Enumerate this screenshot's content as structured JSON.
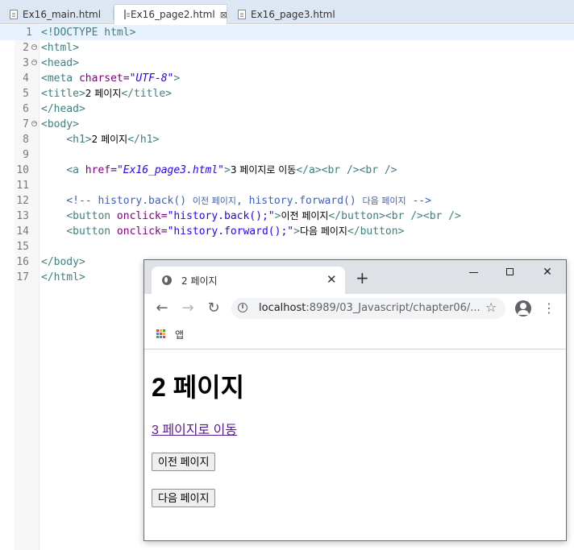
{
  "editor_tabs": [
    {
      "label": "Ex16_main.html",
      "active": false
    },
    {
      "label": "Ex16_page2.html",
      "active": true,
      "close": "⊠"
    },
    {
      "label": "Ex16_page3.html",
      "active": false
    }
  ],
  "code_lines": [
    {
      "n": "1"
    },
    {
      "n": "2"
    },
    {
      "n": "3"
    },
    {
      "n": "4"
    },
    {
      "n": "5"
    },
    {
      "n": "6"
    },
    {
      "n": "7"
    },
    {
      "n": "8"
    },
    {
      "n": "9"
    },
    {
      "n": "10"
    },
    {
      "n": "11"
    },
    {
      "n": "12"
    },
    {
      "n": "13"
    },
    {
      "n": "14"
    },
    {
      "n": "15"
    },
    {
      "n": "16"
    },
    {
      "n": "17"
    }
  ],
  "code": {
    "l1": "<!DOCTYPE html>",
    "l2": "<html>",
    "l3": "<head>",
    "l4_tag": "<meta",
    "l4_attr": " charset=",
    "l4_val": "\"UTF-8\"",
    "l4_end": ">",
    "l5_open": "<title>",
    "l5_text": "2 페이지",
    "l5_close": "</title>",
    "l6": "</head>",
    "l7": "<body>",
    "l8_open": "<h1>",
    "l8_text": "2 페이지",
    "l8_close": "</h1>",
    "l10_tag": "<a",
    "l10_attr": " href=",
    "l10_val": "\"Ex16_page3.html\"",
    "l10_gt": ">",
    "l10_text": "3 페이지로 이동",
    "l10_close": "</a><br /><br />",
    "l12_a": "<!-- history.back() ",
    "l12_b": "이전 페이지",
    "l12_c": ", history.forward() ",
    "l12_d": "다음 페이지",
    "l12_e": " -->",
    "l13_tag": "<button",
    "l13_attr": " onclick=",
    "l13_val": "\"history.back();\"",
    "l13_gt": ">",
    "l13_text": "이전 페이지",
    "l13_close": "</button><br /><br />",
    "l14_tag": "<button",
    "l14_attr": " onclick=",
    "l14_val": "\"history.forward();\"",
    "l14_gt": ">",
    "l14_text": "다음 페이지",
    "l14_close": "</button>",
    "l16": "</body>",
    "l17": "</html>"
  },
  "browser": {
    "tab_title": "2 페이지",
    "tab_close": "✕",
    "new_tab": "+",
    "url_host": "localhost",
    "url_rest": ":8989/03_Javascript/chapter06/...",
    "bookmark_apps": "앱",
    "back": "←",
    "forward": "→",
    "reload": "↻",
    "star": "☆",
    "menu": "⋮",
    "info": "i",
    "close_window": "✕",
    "page": {
      "h1": "2 페이지",
      "link": "3 페이지로 이동",
      "btn_back": "이전 페이지",
      "btn_forward": "다음 페이지"
    }
  },
  "colors": {
    "tag": "#3f7f7f",
    "attribute": "#7f007f",
    "string": "#2a00ff",
    "comment": "#3f5fbf",
    "visited_link": "#551a8b"
  }
}
